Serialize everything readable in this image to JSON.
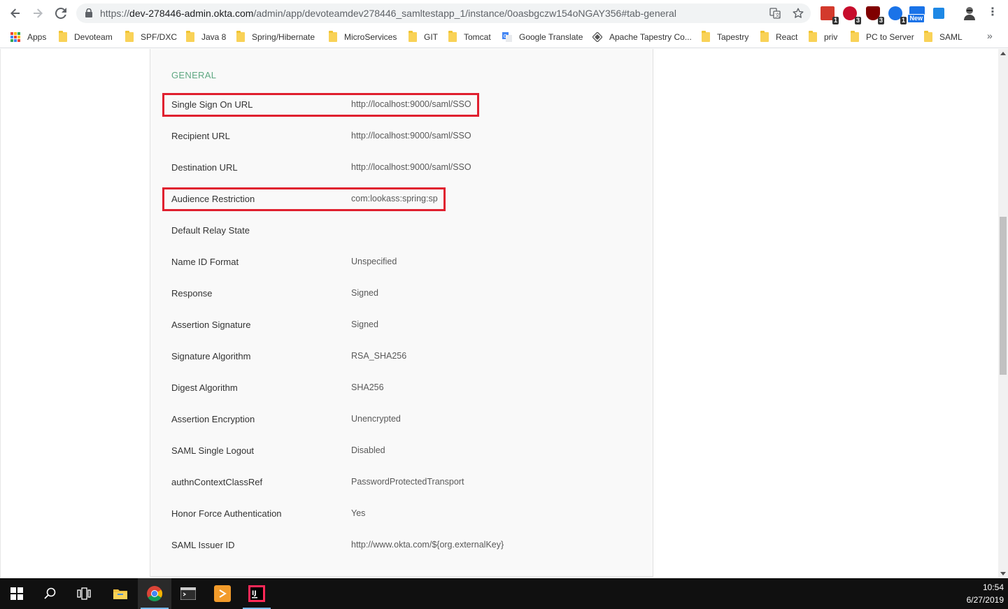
{
  "browser": {
    "url": {
      "scheme": "https://",
      "host": "dev-278446-admin.okta.com",
      "path": "/admin/app/devoteamdev278446_samltestapp_1/instance/0oasbgczw154oNGAY356#tab-general"
    },
    "extensions": [
      {
        "name": "todoist-icon",
        "badge": "1",
        "color": "#d33a2c"
      },
      {
        "name": "abp-icon",
        "badge": "3",
        "color": "#c70d2c"
      },
      {
        "name": "ublock-icon",
        "badge": "3",
        "color": "#800000"
      },
      {
        "name": "extension-icon",
        "badge": "1",
        "color": "#1a73e8"
      },
      {
        "name": "new-extension-icon",
        "badge": "New",
        "color": "#1a73e8"
      },
      {
        "name": "saml-tracer-icon",
        "badge": "",
        "color": "#1e88e5"
      }
    ]
  },
  "bookmarks": [
    {
      "label": "Apps",
      "type": "apps"
    },
    {
      "label": "Devoteam",
      "type": "folder"
    },
    {
      "label": "SPF/DXC",
      "type": "folder"
    },
    {
      "label": "Java 8",
      "type": "folder"
    },
    {
      "label": "Spring/Hibernate",
      "type": "folder"
    },
    {
      "label": "MicroServices",
      "type": "folder"
    },
    {
      "label": "GIT",
      "type": "folder"
    },
    {
      "label": "Tomcat",
      "type": "folder"
    },
    {
      "label": "Google Translate",
      "type": "translate"
    },
    {
      "label": "Apache Tapestry Co...",
      "type": "tapestry"
    },
    {
      "label": "Tapestry",
      "type": "folder"
    },
    {
      "label": "React",
      "type": "folder"
    },
    {
      "label": "priv",
      "type": "folder"
    },
    {
      "label": "PC to Server",
      "type": "folder"
    },
    {
      "label": "SAML",
      "type": "folder"
    }
  ],
  "section": {
    "title": "GENERAL",
    "title_color": "#5fa882",
    "highlight_color": "#e0202f",
    "rows": [
      {
        "label": "Single Sign On URL",
        "value": "http://localhost:9000/saml/SSO",
        "highlighted": true
      },
      {
        "label": "Recipient URL",
        "value": "http://localhost:9000/saml/SSO",
        "highlighted": false
      },
      {
        "label": "Destination URL",
        "value": "http://localhost:9000/saml/SSO",
        "highlighted": false
      },
      {
        "label": "Audience Restriction",
        "value": "com:lookass:spring:sp",
        "highlighted": true
      },
      {
        "label": "Default Relay State",
        "value": "",
        "highlighted": false
      },
      {
        "label": "Name ID Format",
        "value": "Unspecified",
        "highlighted": false
      },
      {
        "label": "Response",
        "value": "Signed",
        "highlighted": false
      },
      {
        "label": "Assertion Signature",
        "value": "Signed",
        "highlighted": false
      },
      {
        "label": "Signature Algorithm",
        "value": "RSA_SHA256",
        "highlighted": false
      },
      {
        "label": "Digest Algorithm",
        "value": "SHA256",
        "highlighted": false
      },
      {
        "label": "Assertion Encryption",
        "value": "Unencrypted",
        "highlighted": false
      },
      {
        "label": "SAML Single Logout",
        "value": "Disabled",
        "highlighted": false
      },
      {
        "label": "authnContextClassRef",
        "value": "PasswordProtectedTransport",
        "highlighted": false
      },
      {
        "label": "Honor Force Authentication",
        "value": "Yes",
        "highlighted": false
      },
      {
        "label": "SAML Issuer ID",
        "value": "http://www.okta.com/${org.externalKey}",
        "highlighted": false
      }
    ]
  },
  "taskbar": {
    "time": "10:54",
    "date": "6/27/2019",
    "apps": [
      "start-icon",
      "search-icon",
      "task-view-icon",
      "file-explorer-icon",
      "chrome-icon",
      "terminal-icon",
      "sublime-icon",
      "intellij-icon"
    ]
  }
}
